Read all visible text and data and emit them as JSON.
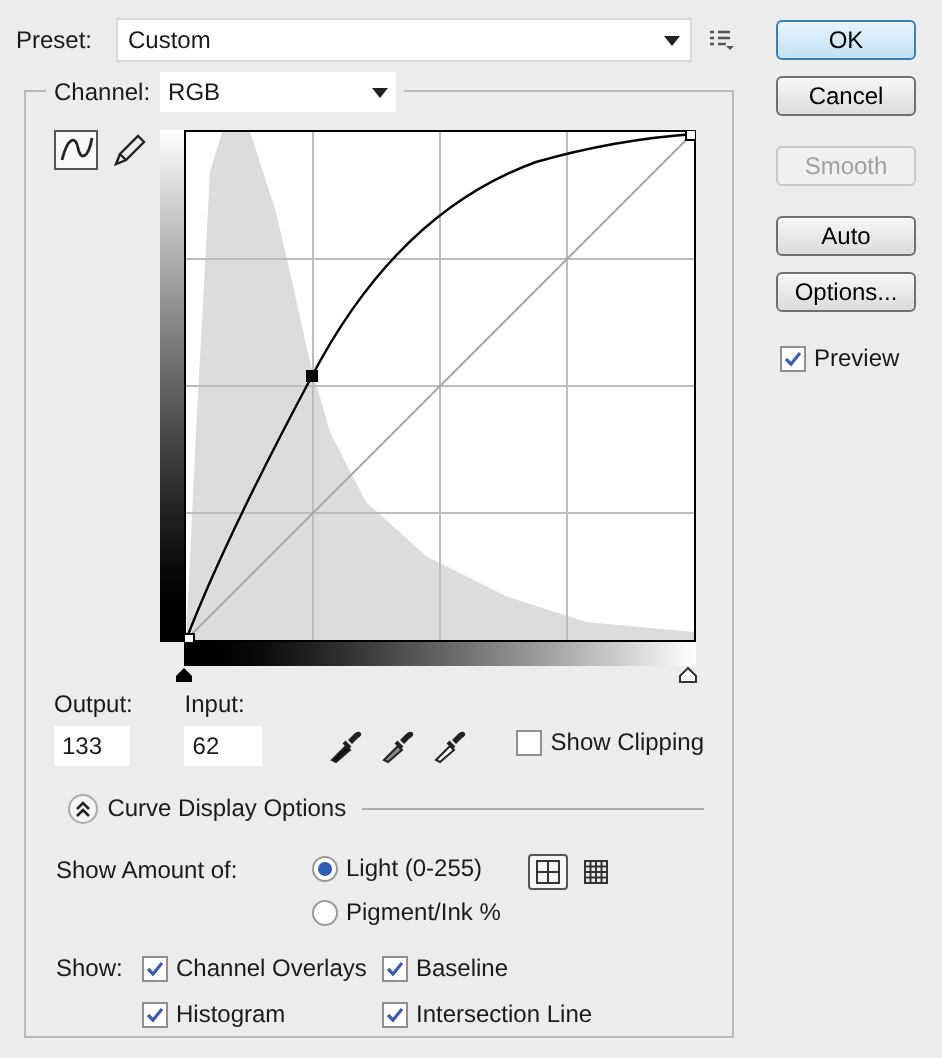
{
  "preset": {
    "label": "Preset:",
    "value": "Custom"
  },
  "buttons": [
    {
      "label": "OK",
      "default": true,
      "disabled": false
    },
    {
      "label": "Cancel",
      "default": false,
      "disabled": false
    },
    {
      "label": "Smooth",
      "default": false,
      "disabled": true
    },
    {
      "label": "Auto",
      "default": false,
      "disabled": false
    },
    {
      "label": "Options...",
      "default": false,
      "disabled": false
    }
  ],
  "preview": {
    "label": "Preview",
    "checked": true
  },
  "channel": {
    "label": "Channel:",
    "value": "RGB"
  },
  "curve_tools": [
    {
      "kind": "curve",
      "selected": true
    },
    {
      "kind": "pencil",
      "selected": false
    }
  ],
  "output": {
    "label": "Output:",
    "value": "133"
  },
  "input": {
    "label": "Input:",
    "value": "62"
  },
  "show_clipping": {
    "label": "Show Clipping",
    "checked": false
  },
  "display_options": {
    "title": "Curve Display Options",
    "expanded": true
  },
  "show_amount": {
    "label": "Show Amount of:",
    "options": [
      {
        "label": "Light  (0-255)",
        "selected": true
      },
      {
        "label": "Pigment/Ink %",
        "selected": false
      }
    ]
  },
  "grid_buttons": [
    {
      "kind": "simple",
      "selected": true
    },
    {
      "kind": "detailed",
      "selected": false
    }
  ],
  "show": {
    "label": "Show:",
    "options": [
      {
        "label": "Channel Overlays",
        "checked": true
      },
      {
        "label": "Baseline",
        "checked": true
      },
      {
        "label": "Histogram",
        "checked": true
      },
      {
        "label": "Intersection Line",
        "checked": true
      }
    ]
  }
}
